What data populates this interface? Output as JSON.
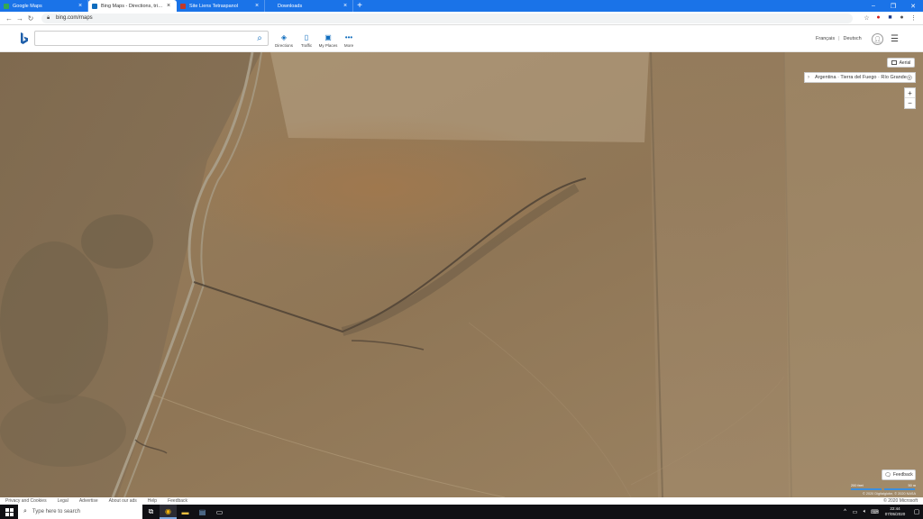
{
  "browser": {
    "tabs": [
      {
        "label": "Google Maps",
        "favicon_color": "#34a853",
        "active": false
      },
      {
        "label": "Bing Maps - Directions, trip planning",
        "favicon_color": "#0f6cbd",
        "active": true
      },
      {
        "label": "Site Liens Tetraspanol",
        "favicon_color": "#c0392b",
        "active": false
      },
      {
        "label": "Downloads",
        "favicon_color": "#1a73e8",
        "active": false
      }
    ],
    "url": "bing.com/maps"
  },
  "bing": {
    "search_value": "",
    "toolbar": [
      {
        "label": "Directions",
        "icon": "directions-icon"
      },
      {
        "label": "Traffic",
        "icon": "traffic-icon"
      },
      {
        "label": "My Places",
        "icon": "my-places-icon"
      },
      {
        "label": "More",
        "icon": "more-icon"
      }
    ],
    "lang_1": "Français",
    "lang_sep": "|",
    "lang_2": "Deutsch"
  },
  "map": {
    "view_button": "Aerial",
    "breadcrumb": "Argentina · Tierra del Fuego · Río Grande",
    "zoom_in": "+",
    "zoom_out": "−",
    "feedback": "Feedback",
    "scale_left": "200 feet",
    "scale_right": "50 m",
    "scale_attrib": "© 2020 Digitalglobe, © 2020 NASA",
    "copyright": "© 2020 Microsoft"
  },
  "footer": {
    "links": [
      "Privacy and Cookies",
      "Legal",
      "Advertise",
      "About our ads",
      "Help",
      "Feedback"
    ]
  },
  "taskbar": {
    "search_placeholder": "Type here to search",
    "time": "22:44",
    "date": "07/05/2020"
  }
}
